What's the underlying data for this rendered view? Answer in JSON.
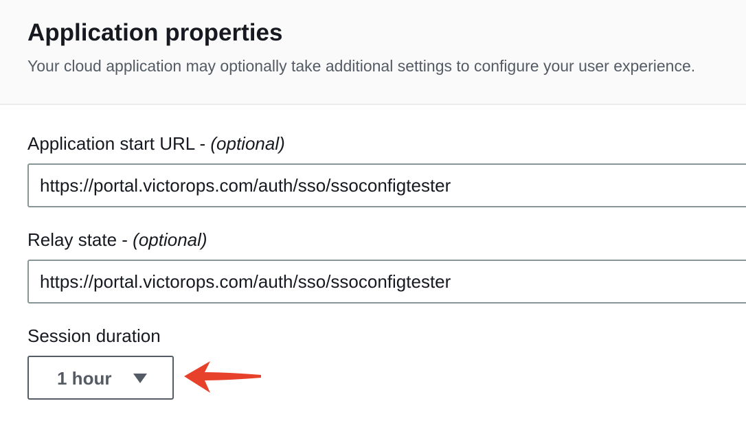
{
  "section": {
    "title": "Application properties",
    "description": "Your cloud application may optionally take additional settings to configure your user experience."
  },
  "fields": {
    "start_url": {
      "label": "Application start URL - ",
      "optional": "(optional)",
      "value": "https://portal.victorops.com/auth/sso/ssoconfigtester"
    },
    "relay_state": {
      "label": "Relay state - ",
      "optional": "(optional)",
      "value": "https://portal.victorops.com/auth/sso/ssoconfigtester"
    },
    "session_duration": {
      "label": "Session duration",
      "selected": "1 hour"
    }
  },
  "icons": {
    "caret": "caret-down-icon",
    "annotation": "red-arrow-icon"
  },
  "colors": {
    "annotation_arrow": "#e8412b",
    "input_border": "#879596",
    "select_text": "#545b64"
  }
}
